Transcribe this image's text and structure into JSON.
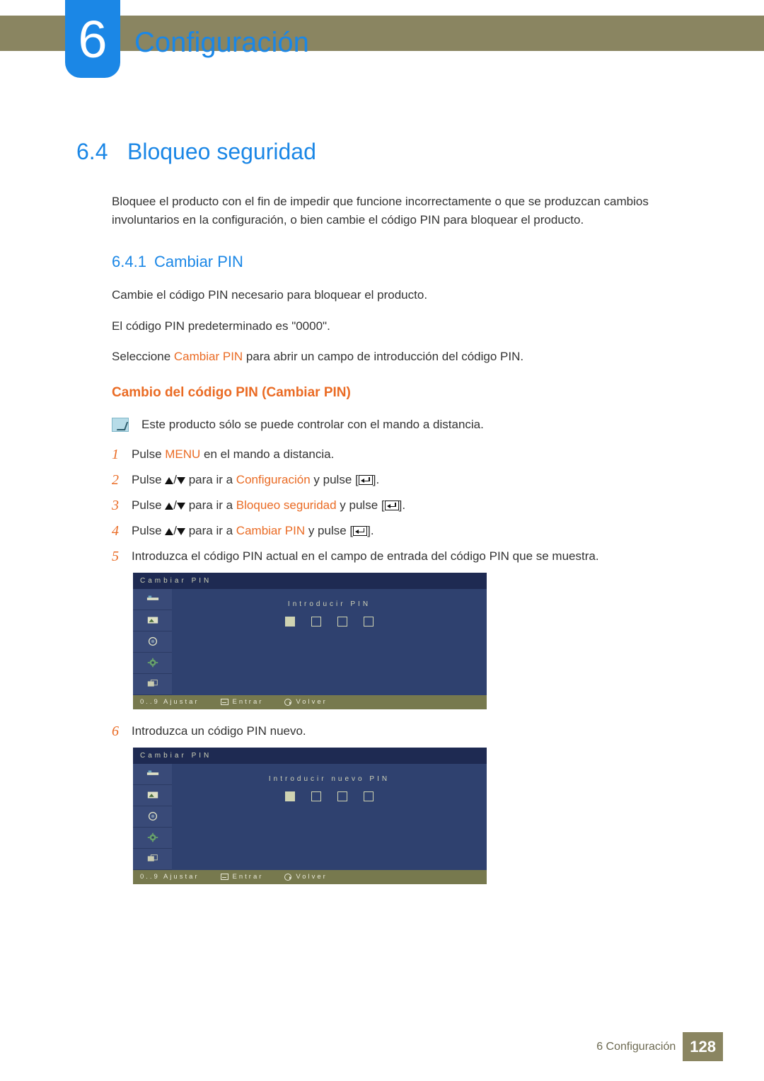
{
  "chapter": {
    "number": "6",
    "title": "Configuración"
  },
  "section": {
    "number": "6.4",
    "title": "Bloqueo seguridad",
    "intro": "Bloquee el producto con el fin de impedir que funcione incorrectamente o que se produzcan cambios involuntarios en la configuración, o bien cambie el código PIN para bloquear el producto."
  },
  "subsection": {
    "number": "6.4.1",
    "title": "Cambiar PIN",
    "p1": "Cambie el código PIN necesario para bloquear el producto.",
    "p2": "El código PIN predeterminado es \"0000\".",
    "p3_pre": "Seleccione ",
    "p3_accent": "Cambiar PIN",
    "p3_post": " para abrir un campo de introducción del código PIN."
  },
  "procedure": {
    "title": "Cambio del código PIN (Cambiar PIN)",
    "note": "Este producto sólo se puede controlar con el mando a distancia.",
    "steps": {
      "s1": {
        "num": "1",
        "pre": "Pulse ",
        "acc": "MENU",
        "post": " en el mando a distancia."
      },
      "s2": {
        "num": "2",
        "pre": "Pulse ",
        "mid": " para ir a ",
        "acc": "Configuración",
        "post": " y pulse [",
        "post2": "]."
      },
      "s3": {
        "num": "3",
        "pre": "Pulse ",
        "mid": " para ir a ",
        "acc": "Bloqueo seguridad",
        "post": " y pulse [",
        "post2": "]."
      },
      "s4": {
        "num": "4",
        "pre": "Pulse ",
        "mid": " para ir a ",
        "acc": "Cambiar PIN",
        "post": " y pulse [",
        "post2": "]."
      },
      "s5": {
        "num": "5",
        "text": "Introduzca el código PIN actual en el campo de entrada del código PIN que se muestra."
      },
      "s6": {
        "num": "6",
        "text": "Introduzca un código PIN nuevo."
      }
    }
  },
  "osd1": {
    "title": "Cambiar PIN",
    "prompt": "Introducir PIN",
    "footer": {
      "adjust": "0..9 Ajustar",
      "enter": "Entrar",
      "back": "Volver"
    }
  },
  "osd2": {
    "title": "Cambiar PIN",
    "prompt": "Introducir nuevo PIN",
    "footer": {
      "adjust": "0..9 Ajustar",
      "enter": "Entrar",
      "back": "Volver"
    }
  },
  "footer": {
    "label": "6 Configuración",
    "page": "128"
  }
}
